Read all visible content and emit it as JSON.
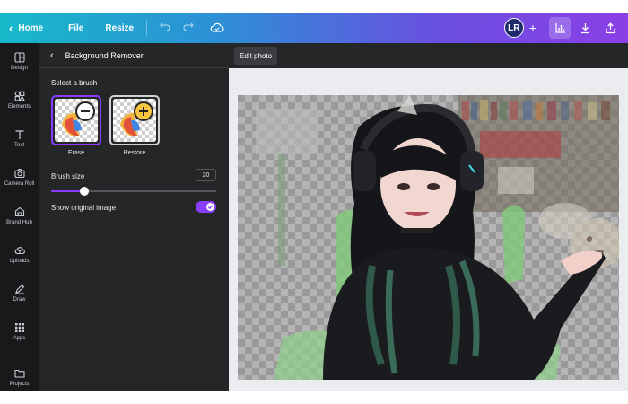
{
  "topbar": {
    "home_label": "Home",
    "file_label": "File",
    "resize_label": "Resize",
    "icons": [
      "chevron-left-icon",
      "undo-icon",
      "redo-icon",
      "cloud-check-icon",
      "bar-chart-icon",
      "download-icon",
      "share-icon"
    ],
    "avatar_initials": "LR",
    "add_label": "+"
  },
  "rail": {
    "items": [
      {
        "label": "Design",
        "icon": "design-icon"
      },
      {
        "label": "Elements",
        "icon": "elements-icon"
      },
      {
        "label": "Text",
        "icon": "text-icon"
      },
      {
        "label": "Camera Roll",
        "icon": "camera-icon"
      },
      {
        "label": "Brand Hub",
        "icon": "brand-hub-icon"
      },
      {
        "label": "Uploads",
        "icon": "upload-cloud-icon"
      },
      {
        "label": "Draw",
        "icon": "draw-icon"
      },
      {
        "label": "Apps",
        "icon": "apps-grid-icon"
      },
      {
        "label": "Projects",
        "icon": "folder-icon"
      }
    ]
  },
  "panel": {
    "title": "Background Remover",
    "select_brush_label": "Select a brush",
    "brushes": [
      {
        "label": "Erase",
        "selected": true
      },
      {
        "label": "Restore",
        "selected": false
      }
    ],
    "brush_size_label": "Brush size",
    "brush_size_value": "20",
    "brush_size_fraction": 0.2,
    "show_original_label": "Show original image",
    "show_original_on": true
  },
  "canvas": {
    "edit_photo_label": "Edit photo"
  },
  "colors": {
    "accent": "#8b3dff",
    "topbar_start": "#17b9c9",
    "topbar_end": "#8b3fe6",
    "rail_bg": "#18191b",
    "panel_bg": "#252627",
    "canvas_bg": "#ebecf0"
  }
}
